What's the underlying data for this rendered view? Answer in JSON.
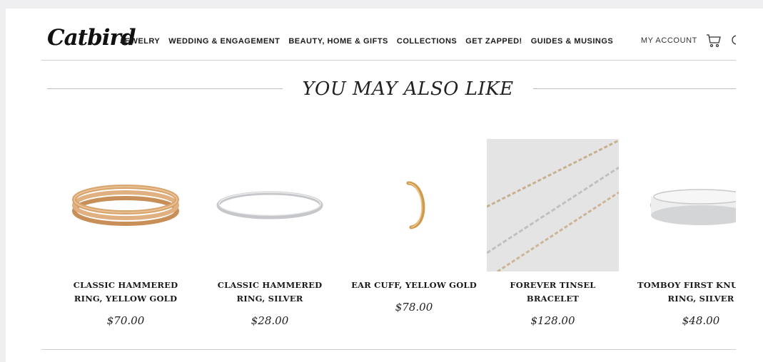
{
  "header": {
    "logo_text": "Catbird",
    "nav": [
      "JEWELRY",
      "WEDDING & ENGAGEMENT",
      "BEAUTY, HOME & GIFTS",
      "COLLECTIONS",
      "GET ZAPPED!",
      "GUIDES & MUSINGS"
    ],
    "account_label": "MY ACCOUNT",
    "icons": [
      "cart-icon",
      "search-icon"
    ]
  },
  "section": {
    "title": "YOU MAY ALSO LIKE"
  },
  "products": [
    {
      "name": "CLASSIC HAMMERED RING, YELLOW GOLD",
      "price": "$70.00",
      "image": "gold-stacked-rings"
    },
    {
      "name": "CLASSIC HAMMERED RING, SILVER",
      "price": "$28.00",
      "image": "silver-ring"
    },
    {
      "name": "EAR CUFF, YELLOW GOLD",
      "price": "$78.00",
      "image": "gold-ear-cuff"
    },
    {
      "name": "FOREVER TINSEL BRACELET",
      "price": "$128.00",
      "image": "tinsel-chains"
    },
    {
      "name": "TOMBOY FIRST KNUCKLE RING, SILVER",
      "price": "$48.00",
      "image": "silver-wide-band"
    }
  ],
  "colors": {
    "background": "#efeff1",
    "page": "#ffffff",
    "rule": "#bdbdbd",
    "text": "#1a1a1a",
    "gold": "#d9a56f",
    "silver": "#c9cacc"
  }
}
